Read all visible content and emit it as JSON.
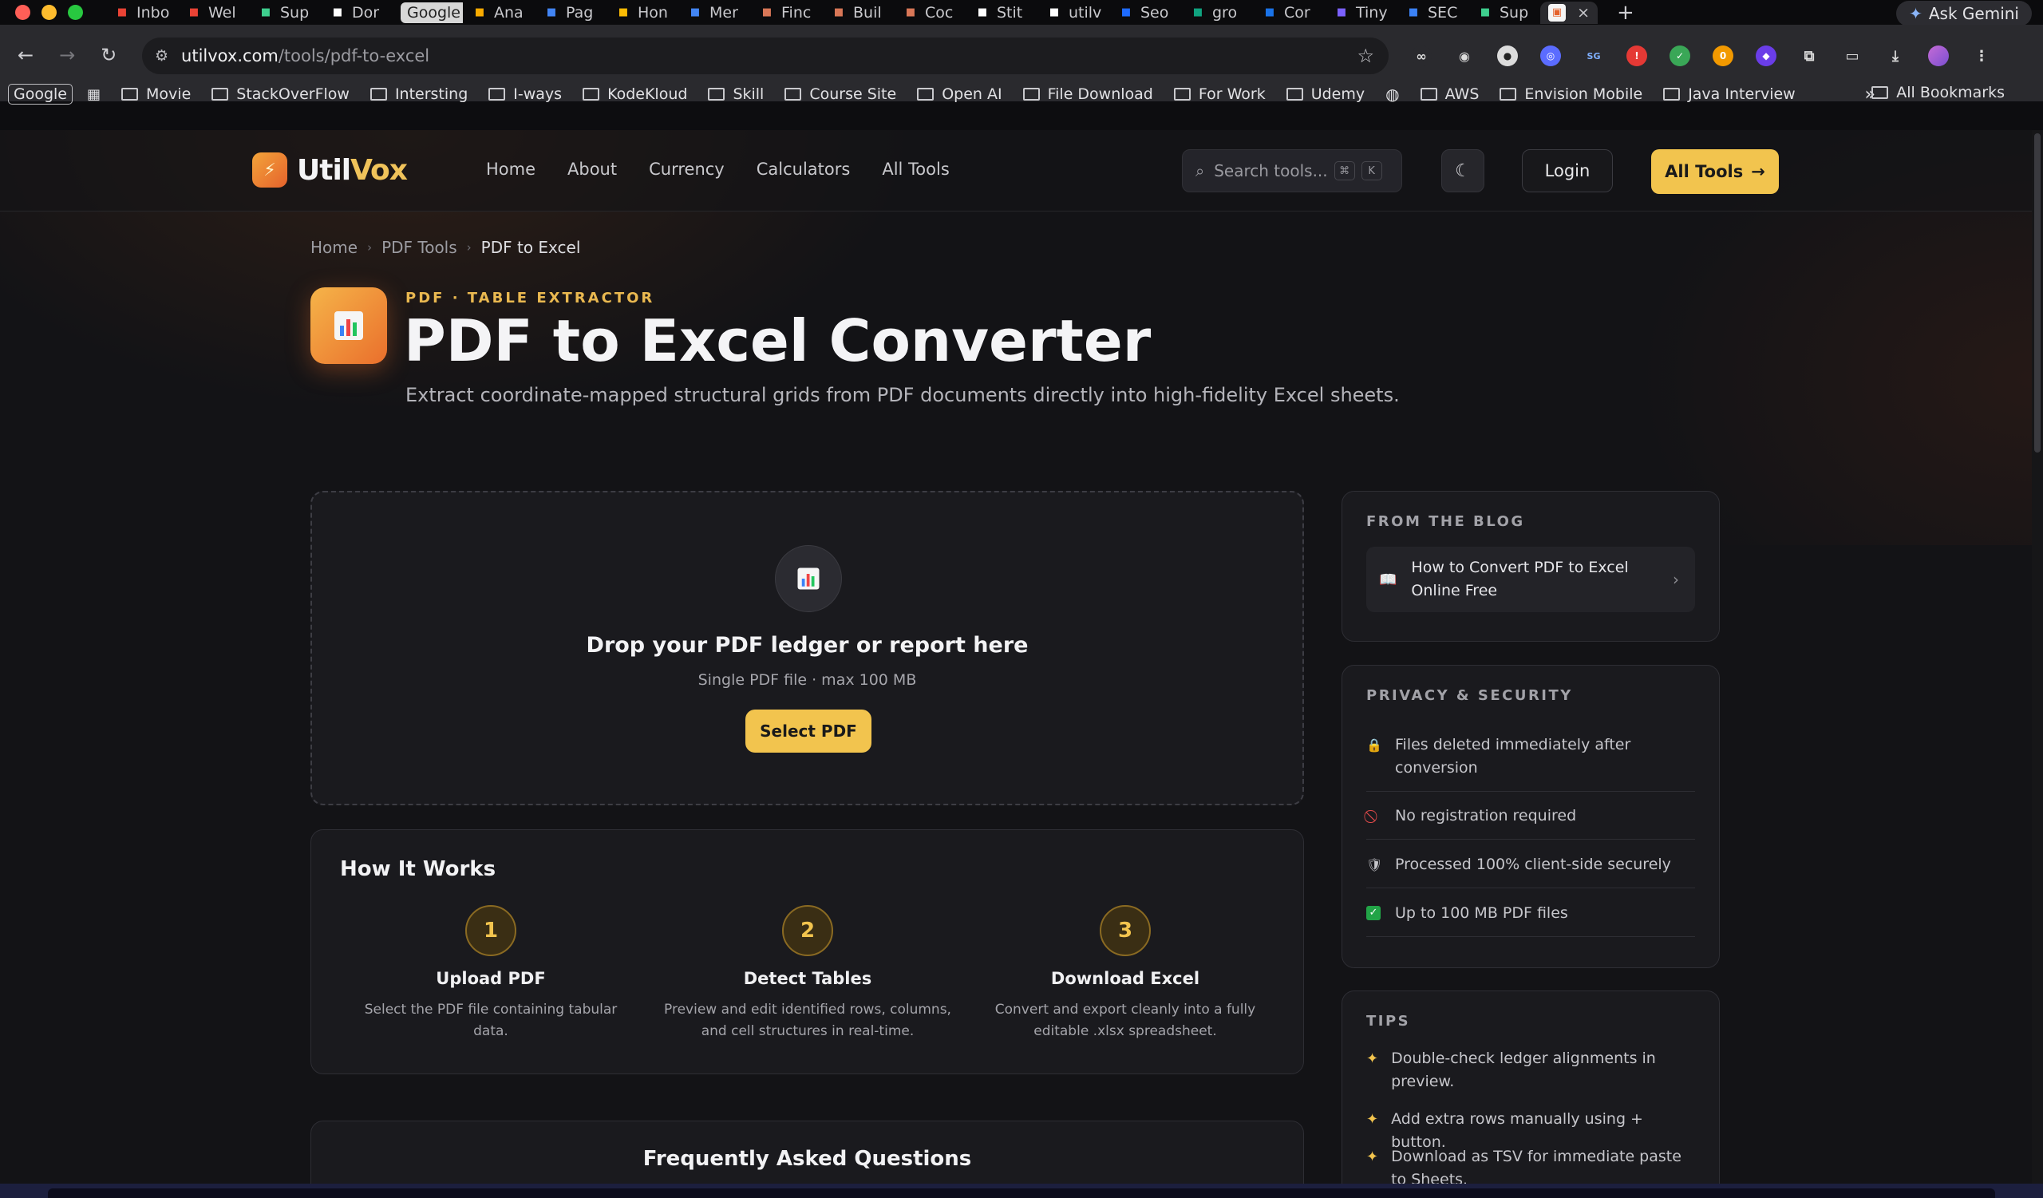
{
  "browser": {
    "tabs": [
      {
        "label": "Inbo",
        "fav": "gmail-icon",
        "color": "#ea4335"
      },
      {
        "label": "Wel",
        "fav": "gmail-icon",
        "color": "#ea4335"
      },
      {
        "label": "Sup",
        "fav": "bolt-icon",
        "color": "#3ecf8e"
      },
      {
        "label": "Dor",
        "fav": "rupee-icon",
        "color": "#ffffff"
      },
      {
        "label": "Google",
        "fav": "google-icon",
        "color": "#d7d7d7"
      },
      {
        "label": "Ana",
        "fav": "analytics-icon",
        "color": "#f9ab00"
      },
      {
        "label": "Pag",
        "fav": "pagespeed-icon",
        "color": "#4285f4"
      },
      {
        "label": "Hon",
        "fav": "ads-icon",
        "color": "#fbbc04"
      },
      {
        "label": "Mer",
        "fav": "gmail-icon",
        "color": "#4285f4"
      },
      {
        "label": "Finc",
        "fav": "claude-icon",
        "color": "#d97757"
      },
      {
        "label": "Buil",
        "fav": "claude-icon",
        "color": "#d97757"
      },
      {
        "label": "Coc",
        "fav": "claude-icon",
        "color": "#d97757"
      },
      {
        "label": "Stit",
        "fav": "stitch-icon",
        "color": "#ffffff"
      },
      {
        "label": "utilv",
        "fav": "triangle-icon",
        "color": "#ffffff"
      },
      {
        "label": "Seo",
        "fav": "seo-icon",
        "color": "#1e6bff"
      },
      {
        "label": "gro",
        "fav": "openai-icon",
        "color": "#10a37f"
      },
      {
        "label": "Cor",
        "fav": "console-icon",
        "color": "#1a73e8"
      },
      {
        "label": "Tiny",
        "fav": "tiny-icon",
        "color": "#7b61ff"
      },
      {
        "label": "SEC",
        "fav": "link-icon",
        "color": "#3b82f6"
      },
      {
        "label": "Sup",
        "fav": "bolt-icon",
        "color": "#3ecf8e"
      }
    ],
    "active_tab_close": "×",
    "new_tab": "+",
    "gemini_label": "Ask Gemini",
    "url_host": "utilvox.com",
    "url_path": "/tools/pdf-to-excel",
    "bookmarks": [
      "Movie",
      "StackOverFlow",
      "Intersting",
      "I-ways",
      "KodeKloud",
      "Skill",
      "Course Site",
      "Open AI",
      "File Download",
      "For Work",
      "Udemy",
      "AWS",
      "Envision Mobile",
      "Java Interview"
    ],
    "bookmark_google": "Google",
    "all_bookmarks": "All Bookmarks",
    "overflow": "»"
  },
  "site": {
    "logo_util": "Util",
    "logo_vox": "Vox",
    "nav": [
      "Home",
      "About",
      "Currency",
      "Calculators",
      "All Tools"
    ],
    "search_placeholder": "Search tools...",
    "kbd_cmd": "⌘",
    "kbd_k": "K",
    "login": "Login",
    "all_tools": "All Tools"
  },
  "breadcrumb": [
    "Home",
    "PDF Tools",
    "PDF to Excel"
  ],
  "hero": {
    "eyebrow": "PDF · TABLE EXTRACTOR",
    "title": "PDF to Excel Converter",
    "subtitle": "Extract coordinate-mapped structural grids from PDF documents directly into high-fidelity Excel sheets."
  },
  "upload": {
    "title": "Drop your PDF ledger or report here",
    "hint": "Single PDF file · max 100 MB",
    "button": "Select PDF"
  },
  "how_it_works": {
    "title": "How It Works",
    "steps": [
      {
        "num": "1",
        "name": "Upload PDF",
        "desc": "Select the PDF file containing tabular data."
      },
      {
        "num": "2",
        "name": "Detect Tables",
        "desc": "Preview and edit identified rows, columns, and cell structures in real-time."
      },
      {
        "num": "3",
        "name": "Download Excel",
        "desc": "Convert and export cleanly into a fully editable .xlsx spreadsheet."
      }
    ]
  },
  "faq": {
    "title": "Frequently Asked Questions"
  },
  "sidebar": {
    "blog_label": "FROM THE BLOG",
    "blog_link": "How to Convert PDF to Excel Online Free",
    "privacy_label": "PRIVACY & SECURITY",
    "privacy_items": [
      {
        "icon": "lock-icon",
        "text": "Files deleted immediately after conversion"
      },
      {
        "icon": "no-entry-icon",
        "text": "No registration required"
      },
      {
        "icon": "shield-icon",
        "text": "Processed 100% client-side securely"
      },
      {
        "icon": "check-icon",
        "text": "Up to 100 MB PDF files"
      }
    ],
    "tips_label": "TIPS",
    "tips": [
      "Double-check ledger alignments in preview.",
      "Add extra rows manually using + button.",
      "Download as TSV for immediate paste to Sheets."
    ]
  },
  "colors": {
    "accent": "#f2c44e",
    "brand_orange": "#ea6f2c",
    "bg": "#131316",
    "card": "#1a1a1e"
  }
}
